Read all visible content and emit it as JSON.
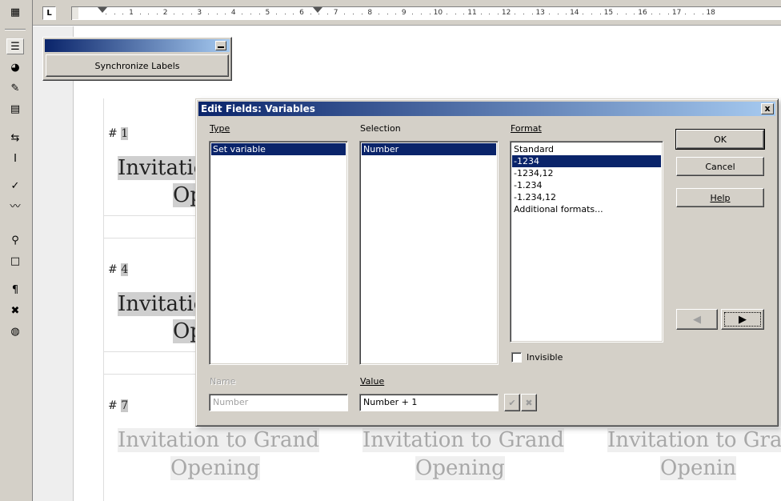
{
  "toolbar": {
    "icons": [
      "insert-table-icon",
      "insert-fields-icon",
      "insert-object-icon",
      "draw-functions-icon",
      "edit-autotext-icon",
      "text-cursor-icon",
      "spellcheck-icon",
      "autospellcheck-icon",
      "find-replace-icon",
      "online-layout-icon",
      "nonprinting-chars-icon",
      "graphics-off-icon",
      "web-layout-icon"
    ]
  },
  "ruler": {
    "corner_label": "L",
    "numbers": [
      "1",
      "2",
      "3",
      "4",
      "5",
      "6",
      "7",
      "8",
      "9",
      "10",
      "11",
      "12",
      "13",
      "14",
      "15",
      "16",
      "17",
      "18"
    ]
  },
  "sync_toolbar": {
    "button_label": "Synchronize Labels"
  },
  "document": {
    "labels": [
      {
        "hash": "#",
        "number": "1",
        "line1": "Invitatio",
        "line2": "Op"
      },
      {
        "hash": "#",
        "number": "4",
        "line1": "Invitatio",
        "line2": "Op"
      },
      {
        "hash": "#",
        "number": "7"
      }
    ],
    "faded_labels": [
      {
        "line1": "Invitation to Grand",
        "line2": "Opening"
      },
      {
        "line1": "Invitation to Grand",
        "line2": "Opening"
      },
      {
        "line1": "Invitation to Gra",
        "line2": "Openin"
      }
    ]
  },
  "dialog": {
    "title": "Edit Fields: Variables",
    "close_label": "x",
    "type_label": "Type",
    "type_items": [
      "Set variable"
    ],
    "selection_label": "Selection",
    "selection_items": [
      "Number"
    ],
    "format_label": "Format",
    "format_items": [
      "Standard",
      "-1234",
      "-1234,12",
      "-1.234",
      "-1.234,12",
      "Additional formats..."
    ],
    "format_selected_index": 1,
    "invisible_label": "Invisible",
    "name_label": "Name",
    "name_value": "Number",
    "value_label": "Value",
    "value_value": "Number + 1",
    "ok_label": "OK",
    "cancel_label": "Cancel",
    "help_label": "Help"
  }
}
